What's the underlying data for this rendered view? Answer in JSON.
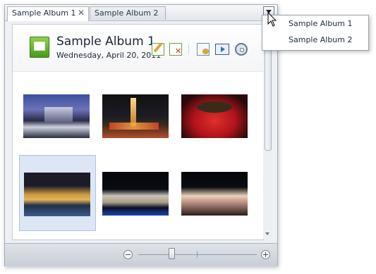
{
  "tabs": [
    {
      "label": "Sample Album 1",
      "active": true,
      "close_symbol": "✕"
    },
    {
      "label": "Sample Album 2",
      "active": false
    }
  ],
  "album": {
    "title": "Sample Album 1",
    "date": "Wednesday, April 20, 2011"
  },
  "toolbar": {
    "icons": [
      "edit-icon",
      "delete-icon",
      "copy-icon",
      "slideshow-icon",
      "settings-icon"
    ]
  },
  "photos": [
    {
      "name": "photo-1",
      "selected": false
    },
    {
      "name": "photo-2",
      "selected": false
    },
    {
      "name": "photo-3",
      "selected": false
    },
    {
      "name": "photo-4",
      "selected": true
    },
    {
      "name": "photo-5",
      "selected": false
    },
    {
      "name": "photo-6",
      "selected": false
    }
  ],
  "zoom": {
    "level_fraction": 0.28
  },
  "dropdown_menu": {
    "items": [
      "Sample Album 1",
      "Sample Album 2"
    ]
  },
  "colors": {
    "selection": "#dde6f5",
    "window_border": "#a6aeb8",
    "album_icon": "#4b9a1f"
  }
}
